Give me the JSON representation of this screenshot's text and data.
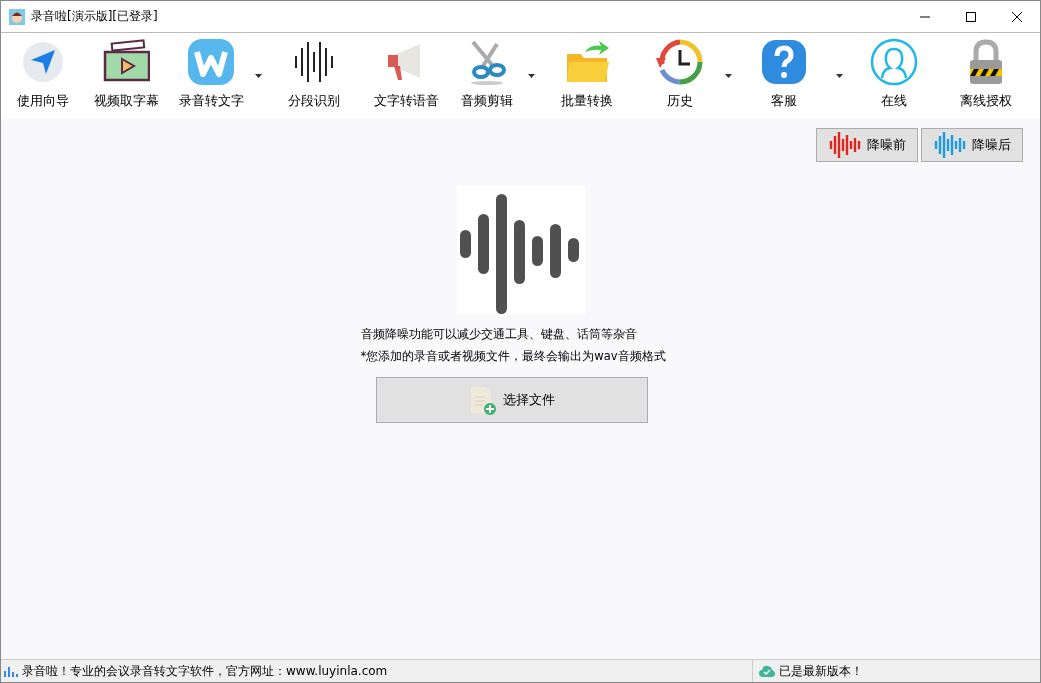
{
  "window": {
    "title": "录音啦[演示版][已登录]"
  },
  "toolbar": [
    {
      "label": "使用向导",
      "has_dropdown": false
    },
    {
      "label": "视频取字幕",
      "has_dropdown": false
    },
    {
      "label": "录音转文字",
      "has_dropdown": true
    },
    {
      "label": "分段识别",
      "has_dropdown": false
    },
    {
      "label": "文字转语音",
      "has_dropdown": false
    },
    {
      "label": "音频剪辑",
      "has_dropdown": true
    },
    {
      "label": "批量转换",
      "has_dropdown": false
    },
    {
      "label": "历史",
      "has_dropdown": true
    },
    {
      "label": "客服",
      "has_dropdown": true
    },
    {
      "label": "在线",
      "has_dropdown": false
    },
    {
      "label": "离线授权",
      "has_dropdown": false
    }
  ],
  "compare_buttons": [
    {
      "label": "降噪前",
      "color": "#e0231c"
    },
    {
      "label": "降噪后",
      "color": "#1e9be0"
    }
  ],
  "description": [
    "音频降噪功能可以减少交通工具、键盘、话筒等杂音",
    "*您添加的录音或者视频文件，最终会输出为wav音频格式"
  ],
  "select_button": {
    "label": "选择文件"
  },
  "status_bar": {
    "left": "录音啦！专业的会议录音转文字软件，官方网址：www.luyinla.com",
    "right": "已是最新版本！"
  }
}
